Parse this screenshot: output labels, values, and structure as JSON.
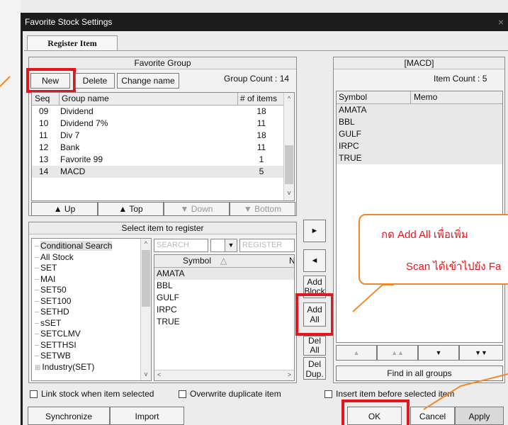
{
  "window": {
    "title": "Favorite Stock Settings",
    "close": "×"
  },
  "tab": "Register Item",
  "favorite_group": {
    "header": "Favorite Group",
    "buttons": {
      "new": "New",
      "delete": "Delete",
      "change_name": "Change name"
    },
    "group_count": "Group Count : 14",
    "columns": {
      "seq": "Seq",
      "name": "Group name",
      "items": "# of items"
    },
    "rows": [
      {
        "seq": "09",
        "name": "Dividend",
        "items": "18"
      },
      {
        "seq": "10",
        "name": "Dividend 7%",
        "items": "11"
      },
      {
        "seq": "11",
        "name": "Div 7",
        "items": "18"
      },
      {
        "seq": "12",
        "name": "Bank",
        "items": "11"
      },
      {
        "seq": "13",
        "name": "Favorite 99",
        "items": "1"
      },
      {
        "seq": "14",
        "name": "MACD",
        "items": "5"
      }
    ],
    "nav": {
      "up": "▲ Up",
      "top": "▲ Top",
      "down": "▼ Down",
      "bottom": "▼ Bottom"
    }
  },
  "select_item": {
    "header": "Select item to register",
    "tree": [
      "Conditional Search",
      "All Stock",
      "SET",
      "MAI",
      "SET50",
      "SET100",
      "SETHD",
      "sSET",
      "SETCLMV",
      "SETTHSI",
      "SETWB",
      "Industry(SET)"
    ],
    "search_placeholder": "SEARCH",
    "register_placeholder": "REGISTER",
    "symbol_col": "Symbol",
    "n_col": "N",
    "symbols": [
      "AMATA",
      "BBL",
      "GULF",
      "IRPC",
      "TRUE"
    ]
  },
  "middle_buttons": {
    "right": "►",
    "left": "◄",
    "add_block": "Add Block",
    "add_all": "Add All",
    "del_all": "Del All",
    "del_dup": "Del Dup."
  },
  "macd": {
    "header": "[MACD]",
    "item_count": "Item Count : 5",
    "columns": {
      "symbol": "Symbol",
      "memo": "Memo"
    },
    "symbols": [
      "AMATA",
      "BBL",
      "GULF",
      "IRPC",
      "TRUE"
    ],
    "nav": {
      "up": "▲",
      "top": "▲▲",
      "down": "▼",
      "bottom": "▼▼"
    },
    "find": "Find in all groups"
  },
  "options": {
    "link": "Link stock when item selected",
    "overwrite": "Overwrite duplicate item",
    "insert": "Insert item before selected item"
  },
  "footer": {
    "sync": "Synchronize",
    "import": "Import",
    "ok": "OK",
    "cancel": "Cancel",
    "apply": "Apply"
  },
  "callout": {
    "line1": "กด Add All เพื่อเพิ่ม",
    "line2": "Scan ได้เข้าไปยัง Fa"
  }
}
